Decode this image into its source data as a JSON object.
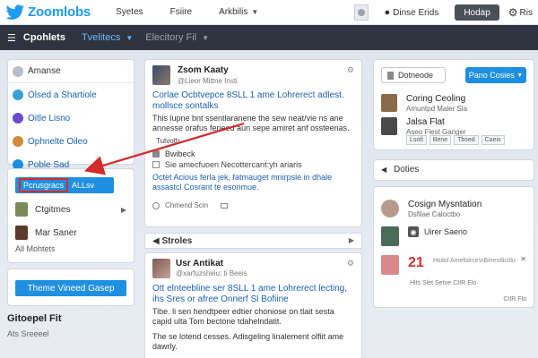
{
  "topbar": {
    "brand": "Zoomlobs",
    "nav": [
      "Syetes",
      "Fsiire",
      "Arkbilis"
    ],
    "user": "Dinse Erids",
    "button": "Hodap",
    "settings": "Ris"
  },
  "subbar": {
    "title": "Cpohlets",
    "active_tab": "Tvelitecs",
    "tab2": "Elecitory Fil"
  },
  "left_list": [
    {
      "label": "Amanse",
      "color": "#b8bcc3"
    },
    {
      "label": "Olsed a Shartiole",
      "color": "#3aa0d8"
    },
    {
      "label": "Oitle Lisno",
      "color": "#6a4ad0"
    },
    {
      "label": "Ophnelte Oileo",
      "color": "#d08a3a"
    },
    {
      "label": "Poble Sad",
      "color": "#1a8fe0"
    }
  ],
  "left_mid": {
    "pill_selected": "Pcrusgracs",
    "pill_rest": "ALLsv",
    "rows": [
      {
        "label": "Ctgitmes",
        "color": "#7a8a5a"
      },
      {
        "label": "Mar Saner",
        "color": "#5a3a2a"
      }
    ],
    "more": "All Mohtets"
  },
  "theme_button": "Theme Vineed Gasep",
  "left_text": {
    "title": "Gitoepel Fit",
    "sub": "Ats Sreeeel"
  },
  "post1": {
    "name": "Zsom Kaaty",
    "handle": "@Lieor Mittne Insti",
    "headline": "Corlae Ocbtvepce 8SLL 1 ame Lohrerect adlest. mollsce sontalks",
    "body": "This lupne bnt ssentlaranene the sew neat/vie ns ane annesse orafus ferieed aun sepe amiret anf ossteenas.",
    "tag": "Tutvoth",
    "switch": "Bwibeck",
    "meta": "Sie amecfuoen Necottercant:yh ariaris",
    "body2": "Octet Acious ferla jek, fatmauget mnirpsle in dhale assastcl Cosrant te esonmue.",
    "actions": "Chmend Scin"
  },
  "stories": "Stroles",
  "post2": {
    "name": "Usr Antikat",
    "handle": "@xarfuzsheiu: ti Beeis",
    "headline": "Ott elnteebline ser 8SLL 1 ame Lohrerect lecting, ihs Sres or afree Onnerf Sl Bofiine",
    "body": "Tibe. li sen hendtpeer edtier choniose on tlait sesta capid ulta Tom bectone tdahelndatit.",
    "body2": "The se lotend cesses. Adisgeling linalement olfiit ame dawrly."
  },
  "right_top": {
    "outline_btn": "Dotneode",
    "blue_btn": "Pano Cosies",
    "items": [
      {
        "name": "Coring Ceoling",
        "sub": "Amuntpd Maler Sla",
        "color": "#8a6a4a"
      },
      {
        "name": "Jalsa Flat",
        "sub": "Aseo Flest Ganger",
        "color": "#4a4a4a"
      }
    ],
    "tags": [
      "Lsotl",
      "Bene",
      "Tbsed",
      "Caeis"
    ]
  },
  "right_doc": "Doties",
  "right_bottom": {
    "items": [
      {
        "name": "Cosign Mysntation",
        "sub": "Dsfilae Caloctbo",
        "color": "#b89a8a"
      },
      {
        "rss": "Uirer Saeno",
        "color": "#4a6a5a"
      }
    ],
    "number": "21",
    "lines": "Hsitol Amefolrce\\nBinentlicitlu",
    "foot": "Hlts Slet Setoe  CIIR Elo",
    "foot2": "CIIR Flo"
  }
}
